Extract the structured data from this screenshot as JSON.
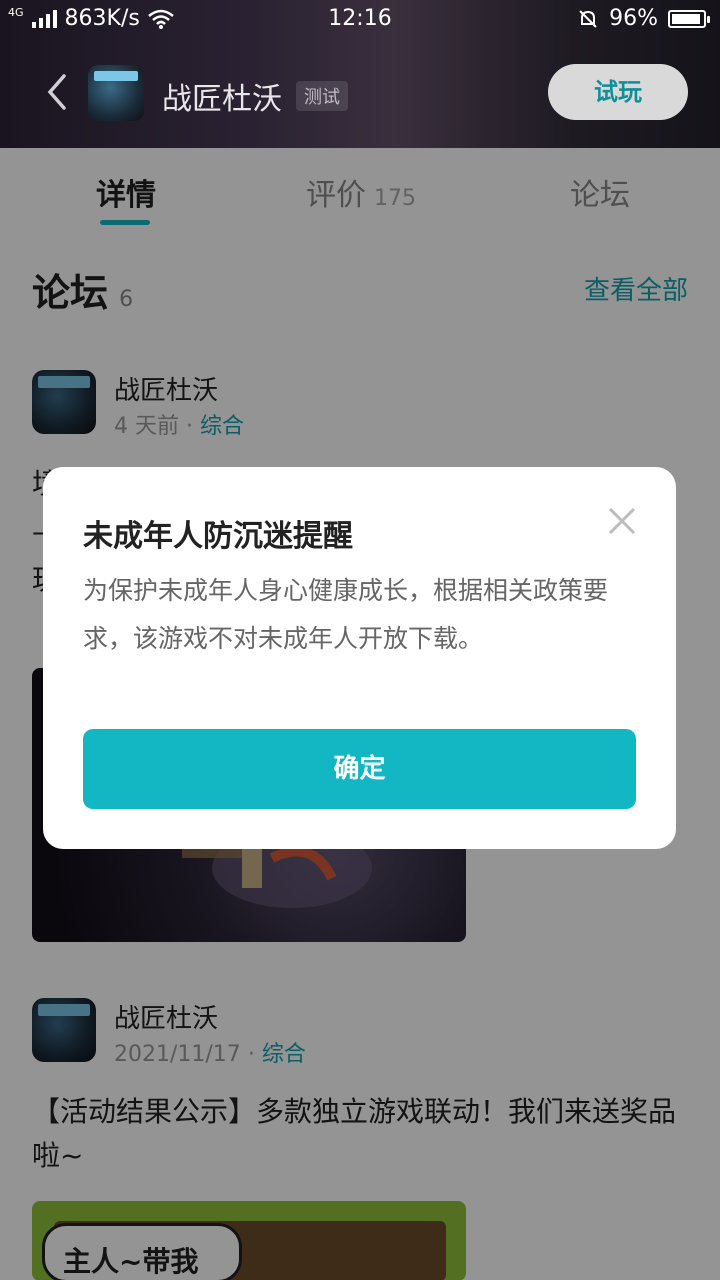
{
  "status": {
    "network": "4G",
    "speed": "863K/s",
    "time": "12:16",
    "battery": "96%"
  },
  "header": {
    "title": "战匠杜沃",
    "tag": "测试",
    "try_label": "试玩"
  },
  "tabs": [
    {
      "label": "详情",
      "count": ""
    },
    {
      "label": "评价",
      "count": "175"
    },
    {
      "label": "论坛",
      "count": ""
    }
  ],
  "forum": {
    "title": "论坛",
    "count": "6",
    "see_all": "查看全部"
  },
  "posts": [
    {
      "author": "战匠杜沃",
      "time": "4 天前",
      "sep": "·",
      "category": "综合",
      "body": "",
      "body_partial_visible": [
        "境",
        "—",
        "玩"
      ]
    },
    {
      "author": "战匠杜沃",
      "time": "2021/11/17",
      "sep": "·",
      "category": "综合",
      "body": "【活动结果公示】多款独立游戏联动！我们来送奖品啦~",
      "image_caption": "主人~带我"
    }
  ],
  "dialog": {
    "title": "未成年人防沉迷提醒",
    "message": "为保护未成年人身心健康成长，根据相关政策要求，该游戏不对未成年人开放下载。",
    "confirm": "确定"
  },
  "colors": {
    "accent": "#13b7c4",
    "link": "#13a3b0",
    "overlay": "rgba(0,0,0,0.42)"
  }
}
